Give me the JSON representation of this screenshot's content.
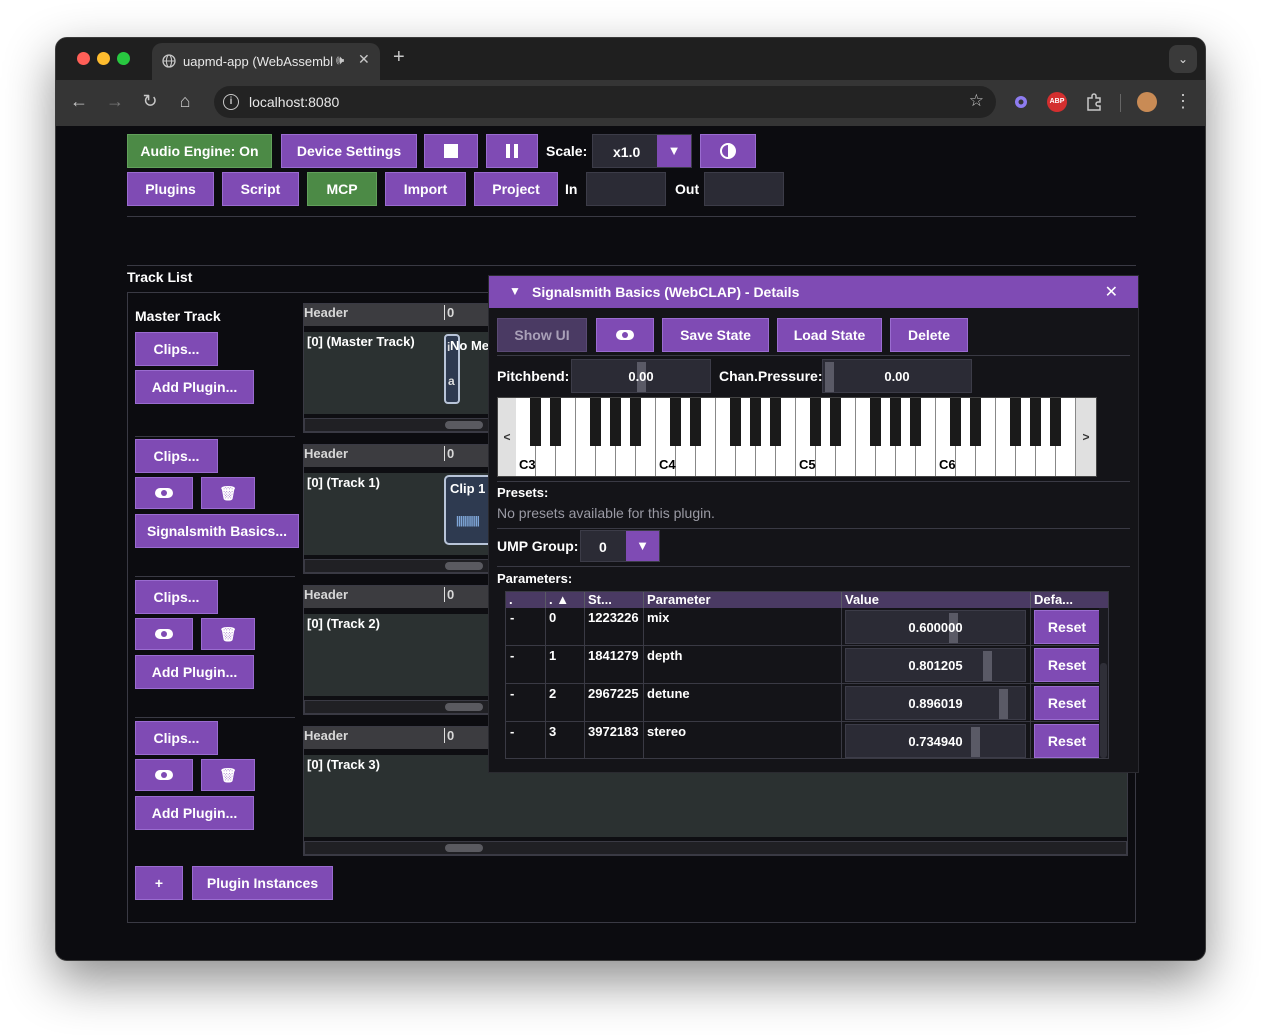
{
  "browser": {
    "tab_title": "uapmd-app (WebAssembl",
    "url": "localhost:8080",
    "extensions": [
      "gear-extension-icon",
      "abp-icon",
      "puzzle-icon",
      "avatar"
    ],
    "abp_label": "ABP"
  },
  "toolbar": {
    "audio_engine": "Audio Engine: On",
    "device_settings": "Device Settings",
    "scale_label": "Scale:",
    "scale_value": "x1.0",
    "plugins": "Plugins",
    "script": "Script",
    "mcp": "MCP",
    "import": "Import",
    "project": "Project",
    "in_label": "In",
    "out_label": "Out"
  },
  "track_list": {
    "title": "Track List",
    "master_title": "Master Track",
    "clips_button": "Clips...",
    "add_plugin_button": "Add Plugin...",
    "signalsmith_button": "Signalsmith Basics...",
    "header_label": "Header",
    "ruler_zero": "0",
    "lanes": [
      {
        "name": "[0] (Master Track)",
        "clip_text_1": "i",
        "clip_text_2": "a",
        "overlay_text": "No Me"
      },
      {
        "name": "[0] (Track 1)",
        "clip_label": "Clip 1"
      },
      {
        "name": "[0] (Track 2)"
      },
      {
        "name": "[0] (Track 3)"
      }
    ],
    "add_track_button": "+",
    "plugin_instances_button": "Plugin Instances"
  },
  "details": {
    "title": "Signalsmith Basics (WebCLAP) - Details",
    "show_ui": "Show UI",
    "save_state": "Save State",
    "load_state": "Load State",
    "delete": "Delete",
    "pitchbend_label": "Pitchbend:",
    "pitchbend_value": "0.00",
    "chan_pressure_label": "Chan.Pressure:",
    "chan_pressure_value": "0.00",
    "piano_left": "<",
    "piano_right": ">",
    "octave_labels": [
      "C3",
      "C4",
      "C5",
      "C6"
    ],
    "presets_label": "Presets:",
    "presets_empty": "No presets available for this plugin.",
    "ump_group_label": "UMP Group:",
    "ump_group_value": "0",
    "parameters_label": "Parameters:",
    "columns": [
      ".",
      ". ▲",
      "St...",
      "Parameter",
      "Value",
      "Defa..."
    ],
    "rows": [
      {
        "flag": "-",
        "index": "0",
        "stable_id": "1223226",
        "name": "mix",
        "value": "0.600000",
        "value_num": 0.6,
        "reset": "Reset"
      },
      {
        "flag": "-",
        "index": "1",
        "stable_id": "1841279",
        "name": "depth",
        "value": "0.801205",
        "value_num": 0.801205,
        "reset": "Reset"
      },
      {
        "flag": "-",
        "index": "2",
        "stable_id": "2967225",
        "name": "detune",
        "value": "0.896019",
        "value_num": 0.896019,
        "reset": "Reset"
      },
      {
        "flag": "-",
        "index": "3",
        "stable_id": "3972183",
        "name": "stereo",
        "value": "0.734940",
        "value_num": 0.73494,
        "reset": "Reset"
      }
    ]
  },
  "colors": {
    "accent": "#7f4bb4",
    "green": "#4c8a46",
    "background": "#0c0c10"
  }
}
